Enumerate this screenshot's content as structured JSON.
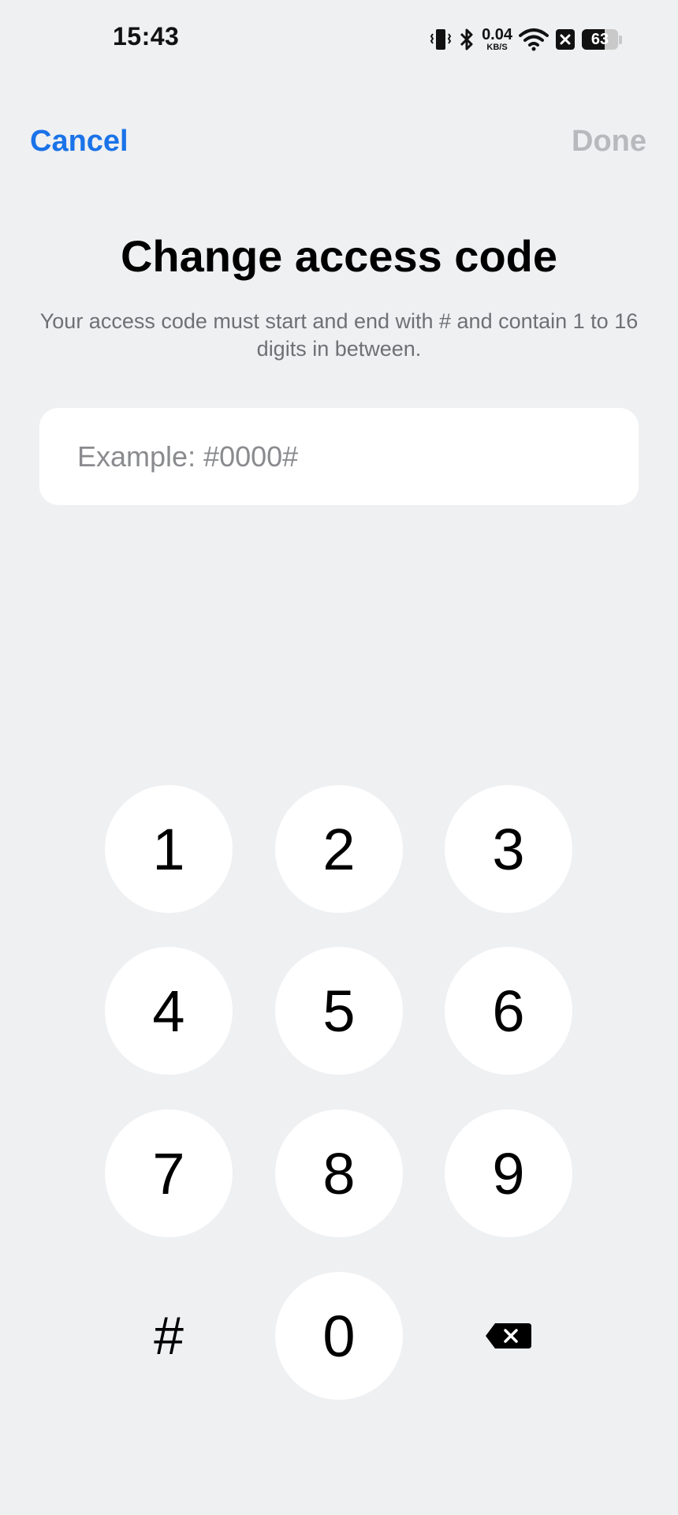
{
  "status_bar": {
    "time": "15:43",
    "net_speed_value": "0.04",
    "net_speed_unit": "KB/S",
    "battery_level": "63",
    "battery_fraction": 0.63,
    "icons": [
      "vibrate-icon",
      "bluetooth-icon",
      "wifi-icon",
      "notification-x-icon",
      "battery-icon"
    ]
  },
  "header": {
    "cancel_label": "Cancel",
    "done_label": "Done"
  },
  "main": {
    "title": "Change access code",
    "description": "Your access code must start and end with # and contain 1 to 16 digits in between.",
    "input": {
      "value": "",
      "placeholder": "Example: #0000#"
    }
  },
  "keypad": {
    "keys": [
      "1",
      "2",
      "3",
      "4",
      "5",
      "6",
      "7",
      "8",
      "9",
      "#",
      "0",
      "backspace-icon"
    ]
  },
  "colors": {
    "accent": "#1a73e8",
    "disabled": "#b8b9bc",
    "background": "#eff0f2"
  }
}
